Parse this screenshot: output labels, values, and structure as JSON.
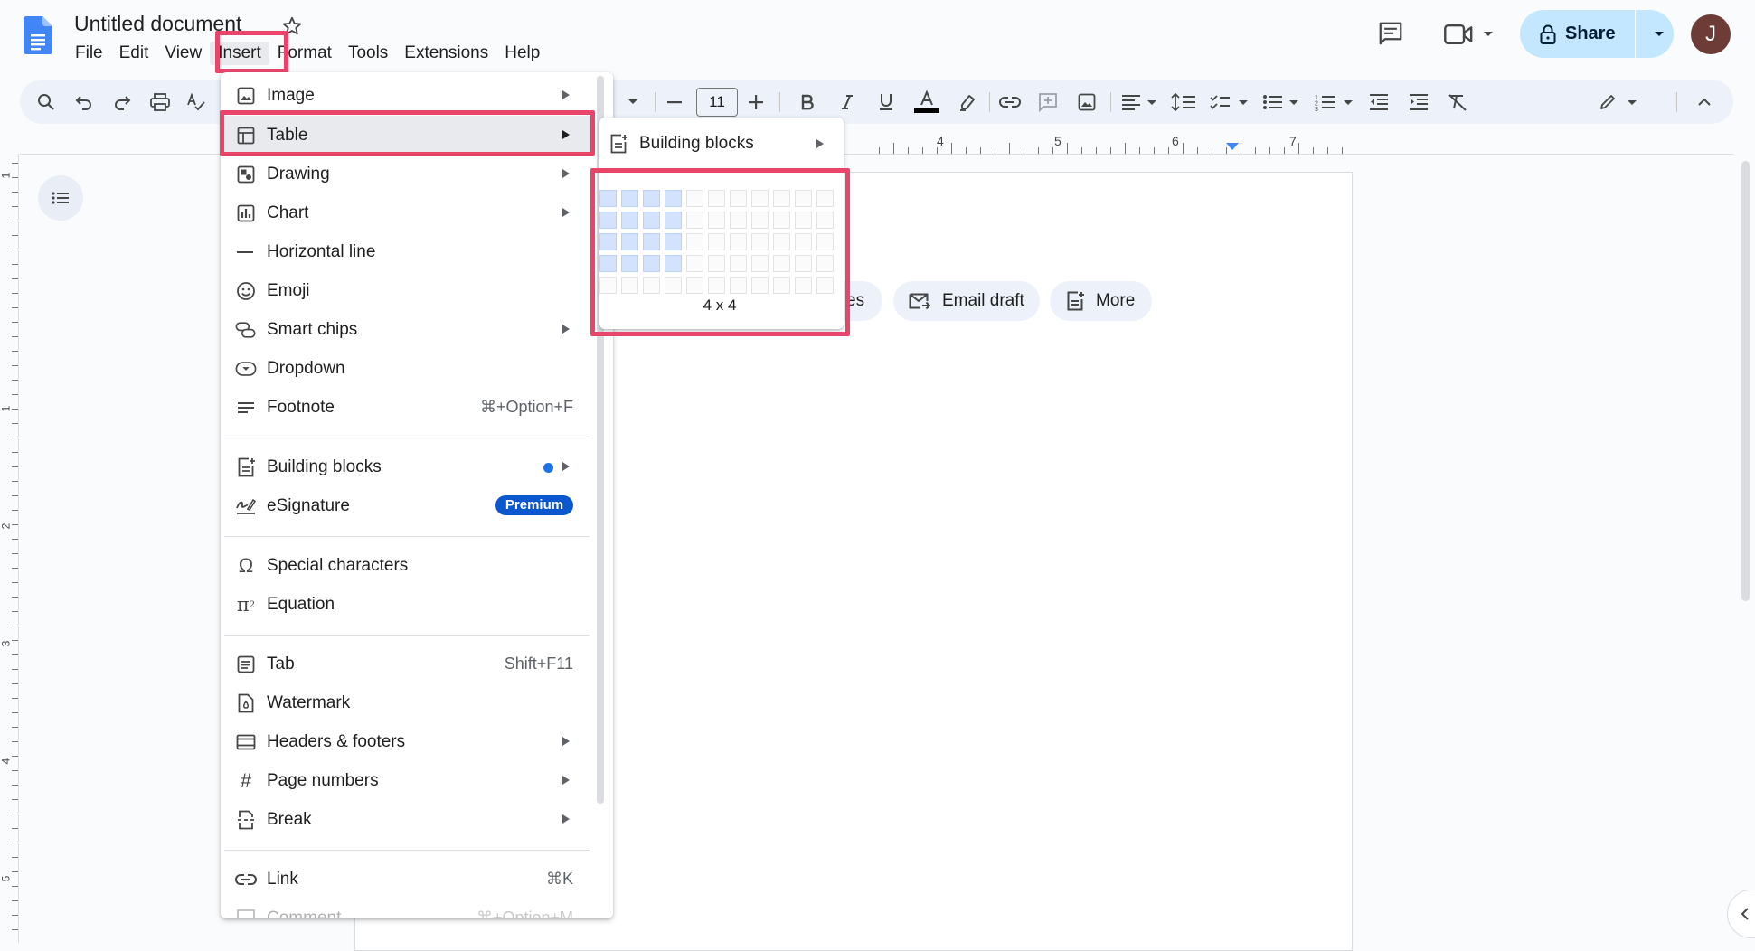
{
  "document": {
    "title": "Untitled document"
  },
  "menubar": {
    "items": [
      {
        "label": "File"
      },
      {
        "label": "Edit"
      },
      {
        "label": "View"
      },
      {
        "label": "Insert"
      },
      {
        "label": "Format"
      },
      {
        "label": "Tools"
      },
      {
        "label": "Extensions"
      },
      {
        "label": "Help"
      }
    ],
    "active_index": 3
  },
  "header": {
    "share_label": "Share",
    "avatar_initial": "J"
  },
  "toolbar": {
    "font_size": "11"
  },
  "ruler": {
    "labels": [
      "4",
      "5",
      "6",
      "7"
    ]
  },
  "left_ruler": {
    "labels": [
      "1",
      "1",
      "2",
      "3",
      "4",
      "5"
    ]
  },
  "chips": {
    "partial_label": "es",
    "email_draft": "Email draft",
    "more": "More"
  },
  "insert_menu": {
    "items": [
      {
        "label": "Image",
        "icon": "image-icon",
        "submenu": true
      },
      {
        "label": "Table",
        "icon": "table-icon",
        "submenu": true
      },
      {
        "label": "Drawing",
        "icon": "drawing-icon",
        "submenu": true
      },
      {
        "label": "Chart",
        "icon": "chart-icon",
        "submenu": true
      },
      {
        "label": "Horizontal line",
        "icon": "horizontal-line-icon"
      },
      {
        "label": "Emoji",
        "icon": "emoji-icon"
      },
      {
        "label": "Smart chips",
        "icon": "smart-chips-icon",
        "submenu": true
      },
      {
        "label": "Dropdown",
        "icon": "dropdown-icon"
      },
      {
        "label": "Footnote",
        "icon": "footnote-icon",
        "shortcut": "⌘+Option+F"
      },
      {
        "label": "Building blocks",
        "icon": "building-blocks-icon",
        "submenu": true
      },
      {
        "label": "eSignature",
        "icon": "esignature-icon",
        "badge": "Premium"
      },
      {
        "label": "Special characters",
        "icon": "omega-icon"
      },
      {
        "label": "Equation",
        "icon": "pi-icon"
      },
      {
        "label": "Tab",
        "icon": "tab-icon",
        "shortcut": "Shift+F11"
      },
      {
        "label": "Watermark",
        "icon": "watermark-icon"
      },
      {
        "label": "Headers & footers",
        "icon": "headers-footers-icon",
        "submenu": true
      },
      {
        "label": "Page numbers",
        "icon": "hash-icon",
        "submenu": true
      },
      {
        "label": "Break",
        "icon": "break-icon",
        "submenu": true
      },
      {
        "label": "Link",
        "icon": "link-icon",
        "shortcut": "⌘K"
      },
      {
        "label": "Comment",
        "icon": "comment-icon",
        "shortcut": "⌘+Option+M"
      }
    ]
  },
  "table_submenu": {
    "building_blocks_label": "Building blocks",
    "grid_cols": 11,
    "grid_rows": 5,
    "selected_cols": 4,
    "selected_rows": 4,
    "size_label": "4 x 4"
  },
  "colors": {
    "highlight_box": "#e9456a",
    "share_bg": "#c2e7ff",
    "selected_cell": "#d3e3fd"
  }
}
